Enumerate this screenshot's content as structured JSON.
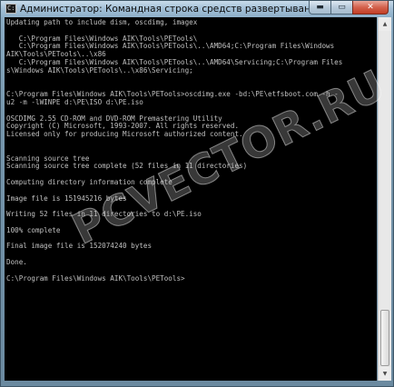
{
  "window": {
    "title": "Администратор: Командная строка средств развертывания",
    "icon_label": "C:\\",
    "buttons": {
      "minimize": "▬",
      "maximize": "▭",
      "close": "✕"
    }
  },
  "console": {
    "lines": [
      "Updating path to include dism, oscdimg, imagex",
      "",
      "   C:\\Program Files\\Windows AIK\\Tools\\PETools\\",
      "   C:\\Program Files\\Windows AIK\\Tools\\PETools\\..\\AMD64;C:\\Program Files\\Windows",
      "AIK\\Tools\\PETools\\..\\x86",
      "   C:\\Program Files\\Windows AIK\\Tools\\PETools\\..\\AMD64\\Servicing;C:\\Program Files",
      "s\\Windows AIK\\Tools\\PETools\\..\\x86\\Servicing;",
      "",
      "",
      "C:\\Program Files\\Windows AIK\\Tools\\PETools>oscdimg.exe -bd:\\PE\\etfsboot.com -h -",
      "u2 -m -lWINPE d:\\PE\\ISO d:\\PE.iso",
      "",
      "OSCDIMG 2.55 CD-ROM and DVD-ROM Premastering Utility",
      "Copyright (C) Microsoft, 1993-2007. All rights reserved.",
      "Licensed only for producing Microsoft authorized content.",
      "",
      "",
      "Scanning source tree",
      "Scanning source tree complete (52 files in 11 directories)",
      "",
      "Computing directory information complete",
      "",
      "Image file is 151945216 bytes",
      "",
      "Writing 52 files in 11 directories to d:\\PE.iso",
      "",
      "100% complete",
      "",
      "Final image file is 152074240 bytes",
      "",
      "Done.",
      "",
      "C:\\Program Files\\Windows AIK\\Tools\\PETools>"
    ]
  },
  "watermark": {
    "text": "PCVECTOR.RU"
  },
  "scrollbar": {
    "up_arrow": "▲",
    "down_arrow": "▼"
  }
}
